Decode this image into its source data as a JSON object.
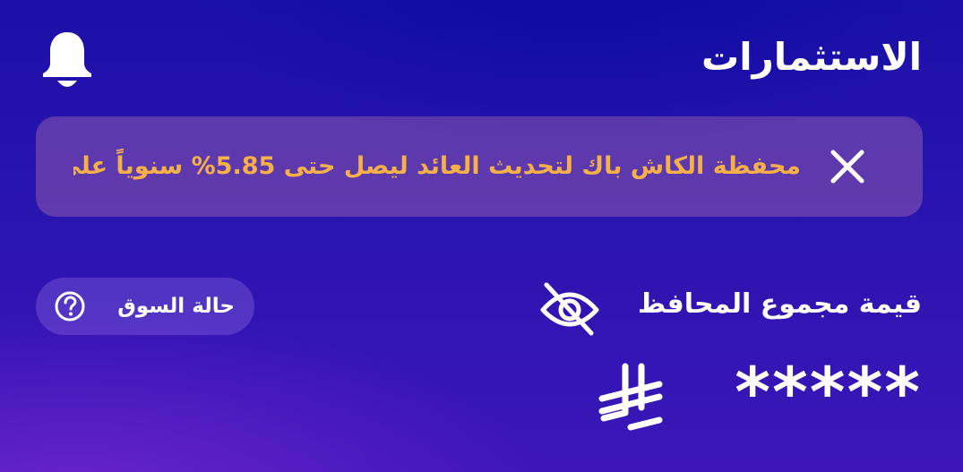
{
  "header": {
    "title": "الاستثمارات",
    "bell_icon": "bell-icon"
  },
  "banner": {
    "text": "محفظة الكاش باك لتحديث العائد ليصل حتى 5.85% سنوياً على",
    "text_color": "#f6b04a",
    "close_icon": "close-icon"
  },
  "market_status": {
    "label": "حالة السوق",
    "help_icon": "question-circle-icon"
  },
  "portfolio": {
    "label": "قيمة مجموع المحافظ",
    "visibility_icon": "eye-off-icon",
    "total_value": "*****",
    "currency_icon": "saudi-riyal-icon"
  }
}
